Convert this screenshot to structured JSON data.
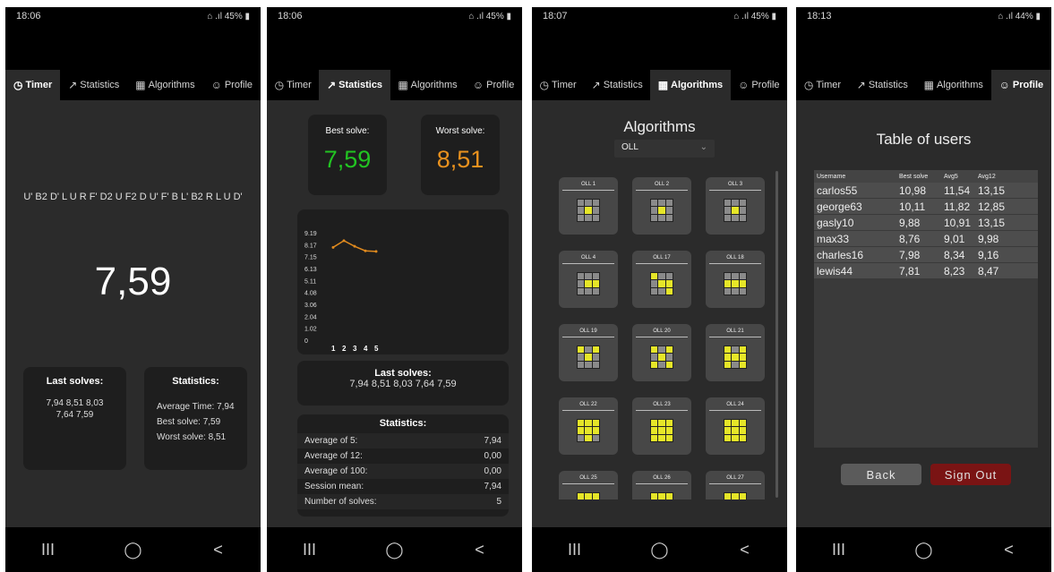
{
  "status": [
    {
      "time": "18:06",
      "right": "⌂ .ıl 45% ▮"
    },
    {
      "time": "18:06",
      "right": "⌂ .ıl 45% ▮"
    },
    {
      "time": "18:07",
      "right": "⌂ .ıl 45% ▮"
    },
    {
      "time": "18:13",
      "right": "⌂ .ıl 44% ▮"
    }
  ],
  "tabs": {
    "timer": "Timer",
    "statistics": "Statistics",
    "algorithms": "Algorithms",
    "profile": "Profile"
  },
  "icons": {
    "timer": "clock-icon",
    "statistics": "trend-icon",
    "algorithms": "grid-icon",
    "profile": "user-circle-icon"
  },
  "nav": {
    "recent": "III",
    "home": "◯",
    "back": "<"
  },
  "timer": {
    "scramble": "U' B2 D' L U R F' D2 U F2 D U' F' B L' B2 R L U D'",
    "time": "7,59",
    "last_solves_title": "Last solves:",
    "last_solves_line1": "7,94  8,51  8,03",
    "last_solves_line2": "7,64  7,59",
    "stats_title": "Statistics:",
    "avg_time": "Average Time: 7,94",
    "best": "Best solve: 7,59",
    "worst": "Worst solve: 8,51"
  },
  "statistics": {
    "best_label": "Best solve:",
    "best_value": "7,59",
    "worst_label": "Worst solve:",
    "worst_value": "8,51",
    "last_solves_title": "Last solves:",
    "last_solves": "7,94  8,51  8,03  7,64  7,59",
    "stats_title": "Statistics:",
    "rows": [
      {
        "label": "Average of 5:",
        "value": "7,94"
      },
      {
        "label": "Average of 12:",
        "value": "0,00"
      },
      {
        "label": "Average of 100:",
        "value": "0,00"
      },
      {
        "label": "Session mean:",
        "value": "7,94"
      },
      {
        "label": "Number of solves:",
        "value": "5"
      }
    ]
  },
  "chart_data": {
    "type": "line",
    "categories": [
      "1",
      "2",
      "3",
      "4",
      "5"
    ],
    "x": [
      1,
      2,
      3,
      4,
      5
    ],
    "series": [
      {
        "values": [
          7.94,
          8.51,
          8.03,
          7.64,
          7.59
        ]
      }
    ],
    "yticks": [
      "9.19",
      "8.17",
      "7.15",
      "6.13",
      "5.11",
      "4.08",
      "3.06",
      "2.04",
      "1.02",
      "0"
    ],
    "ylim": [
      0,
      9.19
    ],
    "color": "#e08a1e",
    "grid": false
  },
  "algorithms": {
    "title": "Algorithms",
    "dropdown_value": "OLL",
    "cases": [
      "OLL 1",
      "OLL 2",
      "OLL 3",
      "OLL 4",
      "OLL 17",
      "OLL 18",
      "OLL 19",
      "OLL 20",
      "OLL 21",
      "OLL 22",
      "OLL 23",
      "OLL 24",
      "OLL 25",
      "OLL 26",
      "OLL 27"
    ]
  },
  "profile": {
    "title": "Table of users",
    "headers": [
      "Username",
      "Best solve",
      "Avg5",
      "Avg12"
    ],
    "rows": [
      [
        "carlos55",
        "10,98",
        "11,54",
        "13,15"
      ],
      [
        "george63",
        "10,11",
        "11,82",
        "12,85"
      ],
      [
        "gasly10",
        "9,88",
        "10,91",
        "13,15"
      ],
      [
        "max33",
        "8,76",
        "9,01",
        "9,98"
      ],
      [
        "charles16",
        "7,98",
        "8,34",
        "9,16"
      ],
      [
        "lewis44",
        "7,81",
        "8,23",
        "8,47"
      ]
    ],
    "back": "Back",
    "signout": "Sign Out"
  },
  "colors": {
    "best": "#22c422",
    "worst": "#e8911e",
    "cube_yellow": "#e6e628",
    "cube_gray": "#8a8a8a",
    "signout_bg": "#7a1414",
    "signout_text": "#e0e0e0",
    "back_bg": "#5b5b5b"
  }
}
